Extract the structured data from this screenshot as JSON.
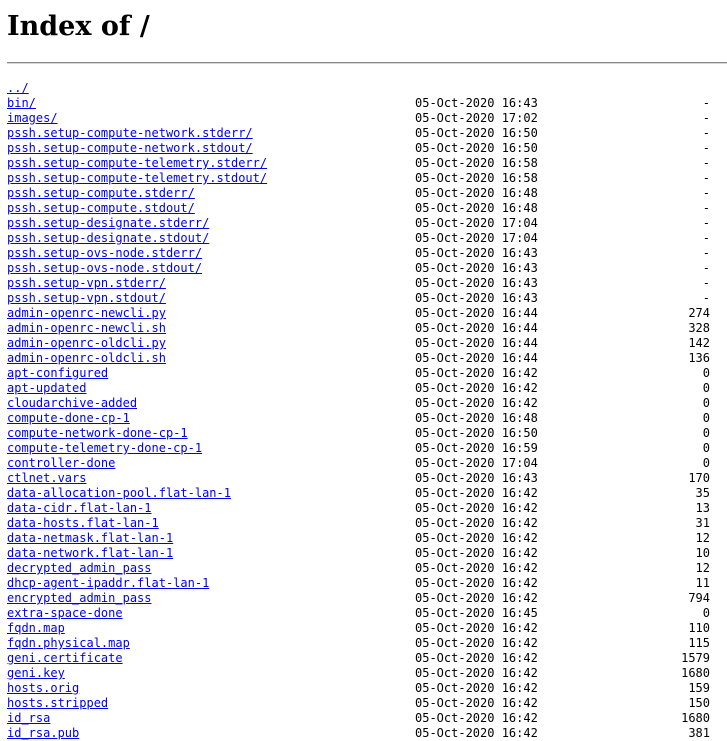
{
  "page": {
    "title": "Index of /"
  },
  "parent": {
    "name": "../"
  },
  "entries": [
    {
      "name": "bin/",
      "date": "05-Oct-2020 16:43",
      "size": "-"
    },
    {
      "name": "images/",
      "date": "05-Oct-2020 17:02",
      "size": "-"
    },
    {
      "name": "pssh.setup-compute-network.stderr/",
      "date": "05-Oct-2020 16:50",
      "size": "-"
    },
    {
      "name": "pssh.setup-compute-network.stdout/",
      "date": "05-Oct-2020 16:50",
      "size": "-"
    },
    {
      "name": "pssh.setup-compute-telemetry.stderr/",
      "date": "05-Oct-2020 16:58",
      "size": "-"
    },
    {
      "name": "pssh.setup-compute-telemetry.stdout/",
      "date": "05-Oct-2020 16:58",
      "size": "-"
    },
    {
      "name": "pssh.setup-compute.stderr/",
      "date": "05-Oct-2020 16:48",
      "size": "-"
    },
    {
      "name": "pssh.setup-compute.stdout/",
      "date": "05-Oct-2020 16:48",
      "size": "-"
    },
    {
      "name": "pssh.setup-designate.stderr/",
      "date": "05-Oct-2020 17:04",
      "size": "-"
    },
    {
      "name": "pssh.setup-designate.stdout/",
      "date": "05-Oct-2020 17:04",
      "size": "-"
    },
    {
      "name": "pssh.setup-ovs-node.stderr/",
      "date": "05-Oct-2020 16:43",
      "size": "-"
    },
    {
      "name": "pssh.setup-ovs-node.stdout/",
      "date": "05-Oct-2020 16:43",
      "size": "-"
    },
    {
      "name": "pssh.setup-vpn.stderr/",
      "date": "05-Oct-2020 16:43",
      "size": "-"
    },
    {
      "name": "pssh.setup-vpn.stdout/",
      "date": "05-Oct-2020 16:43",
      "size": "-"
    },
    {
      "name": "admin-openrc-newcli.py",
      "date": "05-Oct-2020 16:44",
      "size": "274"
    },
    {
      "name": "admin-openrc-newcli.sh",
      "date": "05-Oct-2020 16:44",
      "size": "328"
    },
    {
      "name": "admin-openrc-oldcli.py",
      "date": "05-Oct-2020 16:44",
      "size": "142"
    },
    {
      "name": "admin-openrc-oldcli.sh",
      "date": "05-Oct-2020 16:44",
      "size": "136"
    },
    {
      "name": "apt-configured",
      "date": "05-Oct-2020 16:42",
      "size": "0"
    },
    {
      "name": "apt-updated",
      "date": "05-Oct-2020 16:42",
      "size": "0"
    },
    {
      "name": "cloudarchive-added",
      "date": "05-Oct-2020 16:42",
      "size": "0"
    },
    {
      "name": "compute-done-cp-1",
      "date": "05-Oct-2020 16:48",
      "size": "0"
    },
    {
      "name": "compute-network-done-cp-1",
      "date": "05-Oct-2020 16:50",
      "size": "0"
    },
    {
      "name": "compute-telemetry-done-cp-1",
      "date": "05-Oct-2020 16:59",
      "size": "0"
    },
    {
      "name": "controller-done",
      "date": "05-Oct-2020 17:04",
      "size": "0"
    },
    {
      "name": "ctlnet.vars",
      "date": "05-Oct-2020 16:43",
      "size": "170"
    },
    {
      "name": "data-allocation-pool.flat-lan-1",
      "date": "05-Oct-2020 16:42",
      "size": "35"
    },
    {
      "name": "data-cidr.flat-lan-1",
      "date": "05-Oct-2020 16:42",
      "size": "13"
    },
    {
      "name": "data-hosts.flat-lan-1",
      "date": "05-Oct-2020 16:42",
      "size": "31"
    },
    {
      "name": "data-netmask.flat-lan-1",
      "date": "05-Oct-2020 16:42",
      "size": "12"
    },
    {
      "name": "data-network.flat-lan-1",
      "date": "05-Oct-2020 16:42",
      "size": "10"
    },
    {
      "name": "decrypted_admin_pass",
      "date": "05-Oct-2020 16:42",
      "size": "12"
    },
    {
      "name": "dhcp-agent-ipaddr.flat-lan-1",
      "date": "05-Oct-2020 16:42",
      "size": "11"
    },
    {
      "name": "encrypted_admin_pass",
      "date": "05-Oct-2020 16:42",
      "size": "794"
    },
    {
      "name": "extra-space-done",
      "date": "05-Oct-2020 16:45",
      "size": "0"
    },
    {
      "name": "fqdn.map",
      "date": "05-Oct-2020 16:42",
      "size": "110"
    },
    {
      "name": "fqdn.physical.map",
      "date": "05-Oct-2020 16:42",
      "size": "115"
    },
    {
      "name": "geni.certificate",
      "date": "05-Oct-2020 16:42",
      "size": "1579"
    },
    {
      "name": "geni.key",
      "date": "05-Oct-2020 16:42",
      "size": "1680"
    },
    {
      "name": "hosts.orig",
      "date": "05-Oct-2020 16:42",
      "size": "159"
    },
    {
      "name": "hosts.stripped",
      "date": "05-Oct-2020 16:42",
      "size": "150"
    },
    {
      "name": "id_rsa",
      "date": "05-Oct-2020 16:42",
      "size": "1680"
    },
    {
      "name": "id_rsa.pub",
      "date": "05-Oct-2020 16:42",
      "size": "381"
    }
  ]
}
